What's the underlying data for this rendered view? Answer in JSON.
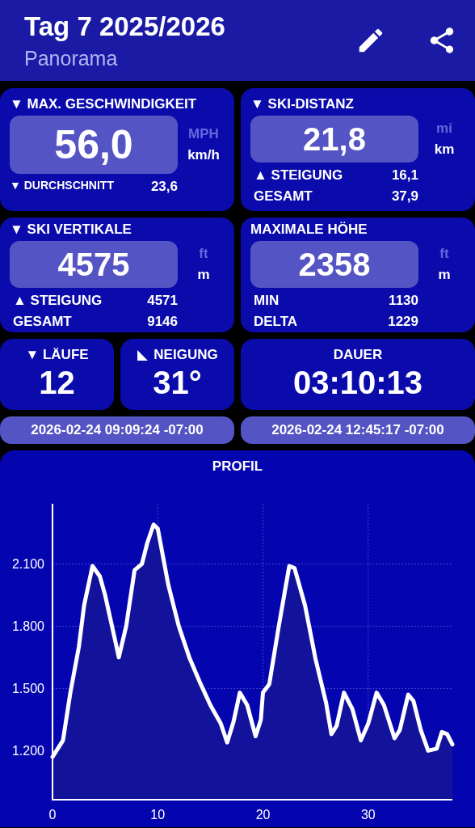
{
  "header": {
    "title": "Tag 7 2025/2026",
    "subtitle": "Panorama"
  },
  "stat_cards": [
    {
      "title": "MAX. GESCHWINDIGKEIT",
      "arrow": "▼",
      "value": "56,0",
      "units": [
        {
          "label": "MPH",
          "selected": false
        },
        {
          "label": "km/h",
          "selected": true
        }
      ],
      "rows": [
        {
          "kind": "minor",
          "arrow": "▼",
          "label": "DURCHSCHNITT",
          "value": "23,6"
        }
      ]
    },
    {
      "title": "SKI-DISTANZ",
      "arrow": "▼",
      "value": "21,8",
      "units": [
        {
          "label": "mi",
          "selected": false
        },
        {
          "label": "km",
          "selected": true
        }
      ],
      "rows": [
        {
          "kind": "normal",
          "arrow": "▲",
          "label": "STEIGUNG",
          "value": "16,1"
        },
        {
          "kind": "normal",
          "label": "GESAMT",
          "value": "37,9"
        }
      ]
    },
    {
      "title": "SKI VERTIKALE",
      "arrow": "▼",
      "value": "4575",
      "units": [
        {
          "label": "ft",
          "selected": false
        },
        {
          "label": "m",
          "selected": true
        }
      ],
      "rows": [
        {
          "kind": "normal",
          "arrow": "▲",
          "label": "STEIGUNG",
          "value": "4571"
        },
        {
          "kind": "normal",
          "label": "GESAMT",
          "value": "9146"
        }
      ]
    },
    {
      "title": "MAXIMALE HÖHE",
      "value": "2358",
      "units": [
        {
          "label": "ft",
          "selected": false
        },
        {
          "label": "m",
          "selected": true
        }
      ],
      "rows": [
        {
          "kind": "normal",
          "label": "MIN",
          "value": "1130"
        },
        {
          "kind": "normal",
          "label": "DELTA",
          "value": "1229"
        }
      ]
    }
  ],
  "small_cards": [
    {
      "kind": "arrow",
      "title": "LÄUFE",
      "arrow": "▼",
      "value": "12"
    },
    {
      "kind": "slope",
      "title": "NEIGUNG",
      "value": "31°"
    }
  ],
  "duration": {
    "title": "DAUER",
    "value": "03:10:13"
  },
  "times": [
    "2026-02-24 09:09:24 -07:00",
    "2026-02-24 12:45:17 -07:00"
  ],
  "profile": {
    "chart_data": {
      "type": "area",
      "title": "PROFIL",
      "x": [
        0,
        1,
        1.7,
        2.5,
        3,
        3.8,
        4.5,
        5,
        6,
        6.3,
        7,
        7.8,
        8.5,
        9,
        9.6,
        10,
        11,
        12,
        13,
        14,
        15,
        16,
        16.6,
        17.2,
        17.8,
        18.5,
        19.3,
        19.8,
        20,
        20.6,
        21.5,
        22.5,
        23,
        24,
        25,
        26,
        26.5,
        27,
        27.7,
        28.5,
        29.3,
        30,
        30.8,
        31.5,
        32.5,
        33,
        33.8,
        34.3,
        35,
        35.7,
        36.5,
        37,
        37.5,
        38
      ],
      "grid": true,
      "series": [
        {
          "color": "#ffffff",
          "values": [
            1170,
            1250,
            1480,
            1700,
            1900,
            2090,
            2040,
            1950,
            1720,
            1650,
            1800,
            2070,
            2100,
            2200,
            2290,
            2270,
            2000,
            1800,
            1650,
            1530,
            1420,
            1330,
            1240,
            1340,
            1480,
            1420,
            1270,
            1350,
            1480,
            1520,
            1800,
            2090,
            2080,
            1900,
            1640,
            1430,
            1280,
            1320,
            1480,
            1400,
            1250,
            1330,
            1480,
            1420,
            1260,
            1300,
            1470,
            1440,
            1300,
            1200,
            1210,
            1290,
            1280,
            1230
          ]
        }
      ],
      "xlim": [
        0,
        38
      ],
      "ylim": [
        964,
        2390
      ],
      "xticks": [
        0,
        10,
        20,
        30
      ],
      "yticks": [
        {
          "value": 1200,
          "label": "1.200"
        },
        {
          "value": 1500,
          "label": "1.500"
        },
        {
          "value": 1800,
          "label": "1.800"
        },
        {
          "value": 2100,
          "label": "2.100"
        }
      ]
    }
  }
}
